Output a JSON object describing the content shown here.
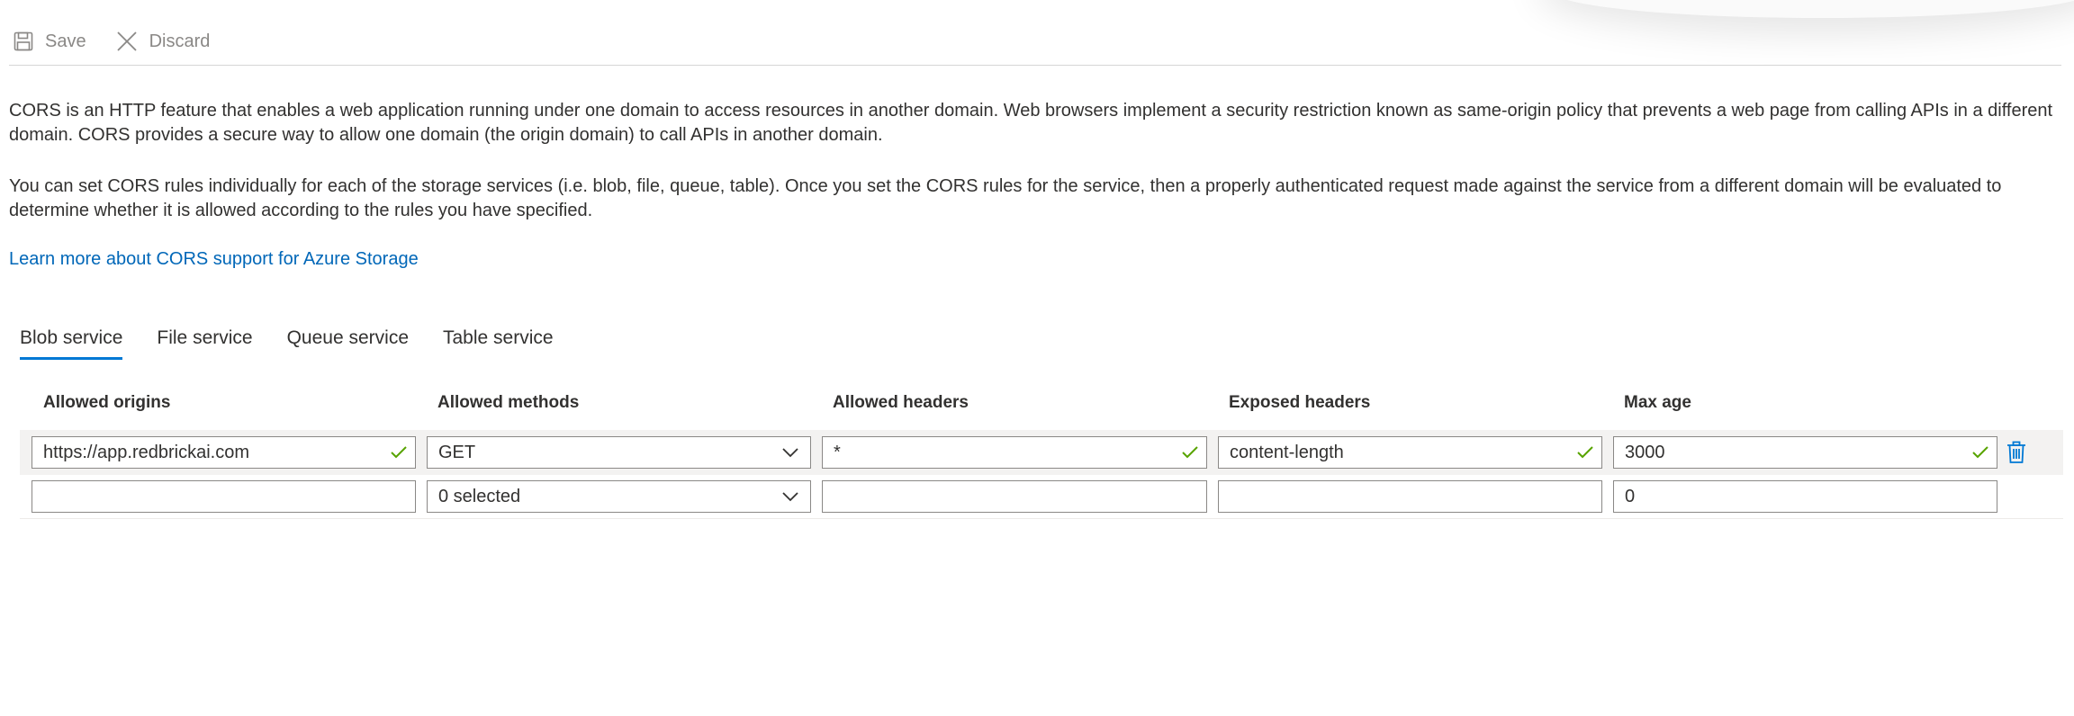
{
  "toolbar": {
    "save_label": "Save",
    "discard_label": "Discard"
  },
  "description": {
    "paragraph1": "CORS is an HTTP feature that enables a web application running under one domain to access resources in another domain. Web browsers implement a security restriction known as same-origin policy that prevents a web page from calling APIs in a different domain. CORS provides a secure way to allow one domain (the origin domain) to call APIs in another domain.",
    "paragraph2": "You can set CORS rules individually for each of the storage services (i.e. blob, file, queue, table). Once you set the CORS rules for the service, then a properly authenticated request made against the service from a different domain will be evaluated to determine whether it is allowed according to the rules you have specified.",
    "learn_more": "Learn more about CORS support for Azure Storage"
  },
  "tabs": [
    {
      "label": "Blob service",
      "active": true
    },
    {
      "label": "File service",
      "active": false
    },
    {
      "label": "Queue service",
      "active": false
    },
    {
      "label": "Table service",
      "active": false
    }
  ],
  "grid": {
    "headers": {
      "origins": "Allowed origins",
      "methods": "Allowed methods",
      "allowed_headers": "Allowed headers",
      "exposed_headers": "Exposed headers",
      "max_age": "Max age"
    },
    "rows": [
      {
        "origins": "https://app.redbrickai.com",
        "methods": "GET",
        "allowed_headers": "*",
        "exposed_headers": "content-length",
        "max_age": "3000"
      },
      {
        "origins": "",
        "methods": "0 selected",
        "allowed_headers": "",
        "exposed_headers": "",
        "max_age": "0"
      }
    ]
  },
  "colors": {
    "link": "#0067b8",
    "accent": "#0078d4",
    "valid_check": "#57a300",
    "delete_icon": "#0078d4"
  },
  "icons": {
    "save": "floppy-disk-icon",
    "discard": "close-icon",
    "valid": "checkmark-icon",
    "dropdown": "chevron-down-icon",
    "delete": "trash-icon"
  }
}
